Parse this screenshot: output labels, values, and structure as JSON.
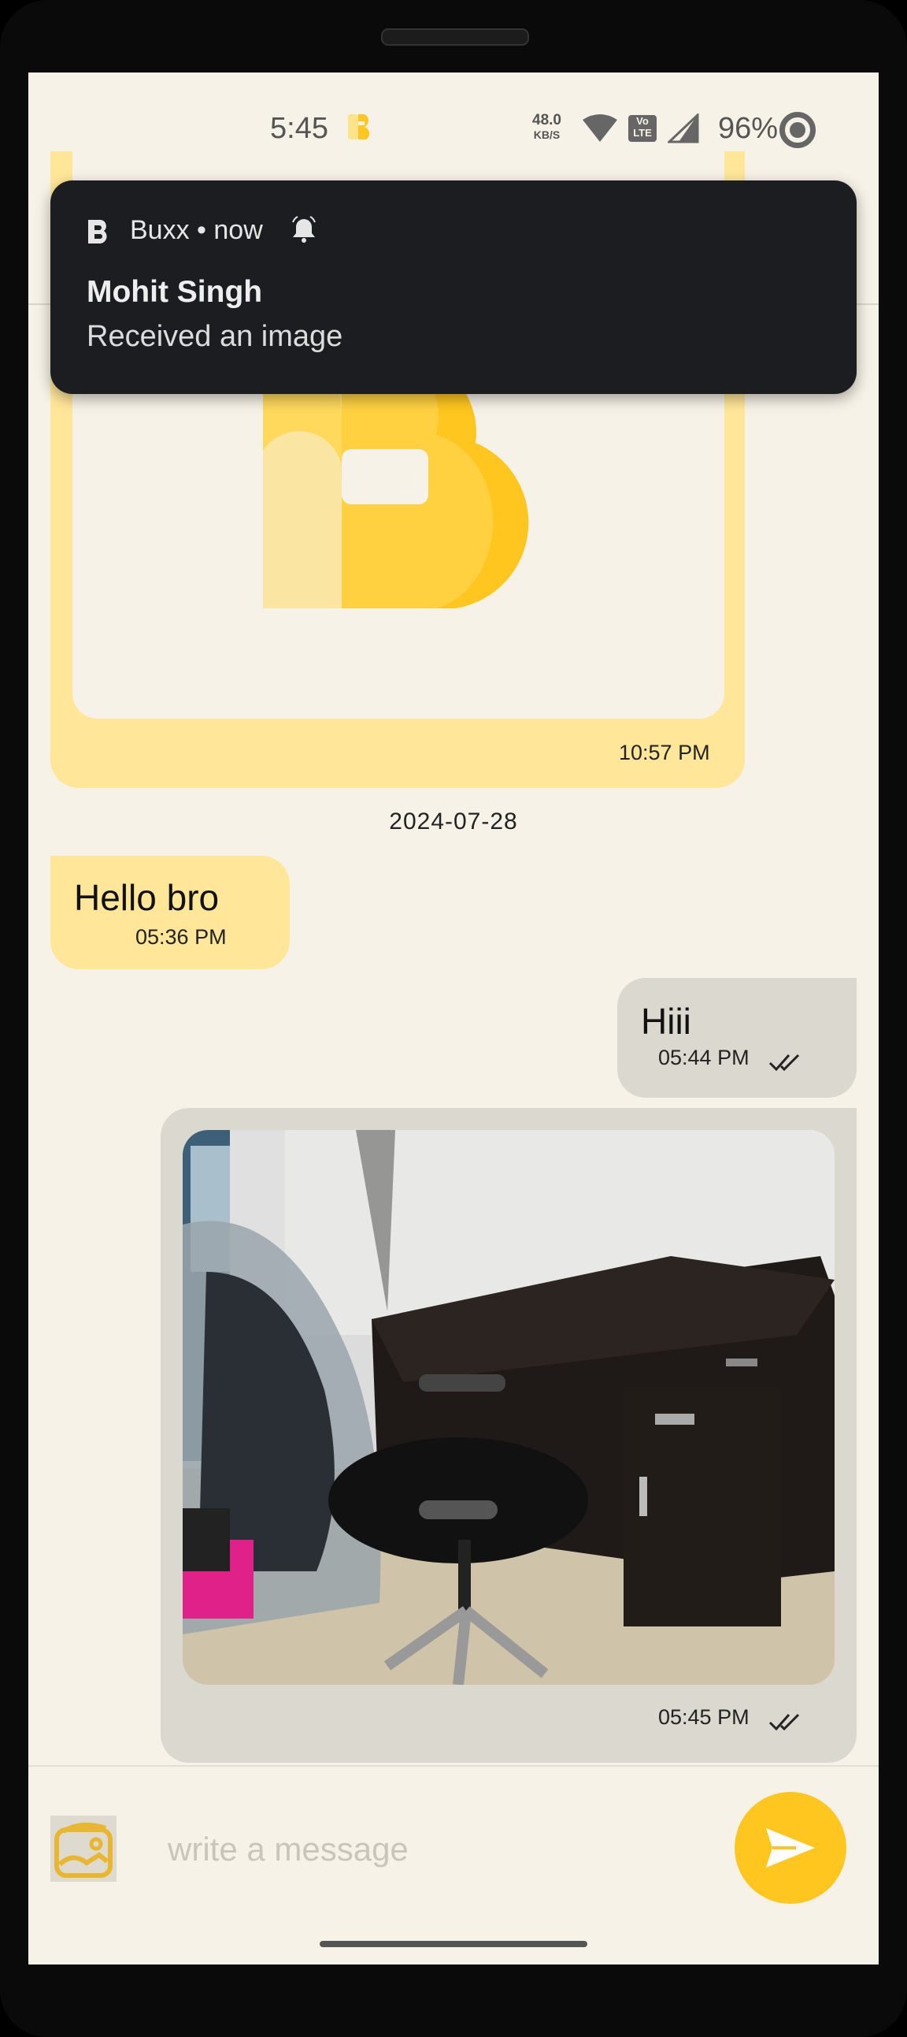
{
  "status_bar": {
    "time": "5:45",
    "net_speed_value": "48.0",
    "net_speed_unit": "KB/S",
    "volte": "Vo LTE",
    "battery": "96%"
  },
  "notification": {
    "app_name": "Buxx • now",
    "title": "Mohit Singh",
    "text": "Received an image"
  },
  "messages": {
    "incoming_image_time": "10:57 PM",
    "date_separator": "2024-07-28",
    "incoming_text": "Hello bro",
    "incoming_text_time": "05:36 PM",
    "outgoing_text": "Hiii",
    "outgoing_text_time": "05:44 PM",
    "outgoing_image_time": "05:45 PM"
  },
  "composer": {
    "placeholder": "write a message"
  },
  "colors": {
    "background": "#f6f2e7",
    "incoming_bubble": "#ffe699",
    "outgoing_bubble": "#dbd9cf",
    "accent": "#ffc61f",
    "notification_bg": "#1c1d20"
  },
  "icons": {
    "gallery": "image-gallery-icon",
    "send": "send-icon",
    "delivered": "double-check-icon",
    "bell": "bell-icon"
  }
}
